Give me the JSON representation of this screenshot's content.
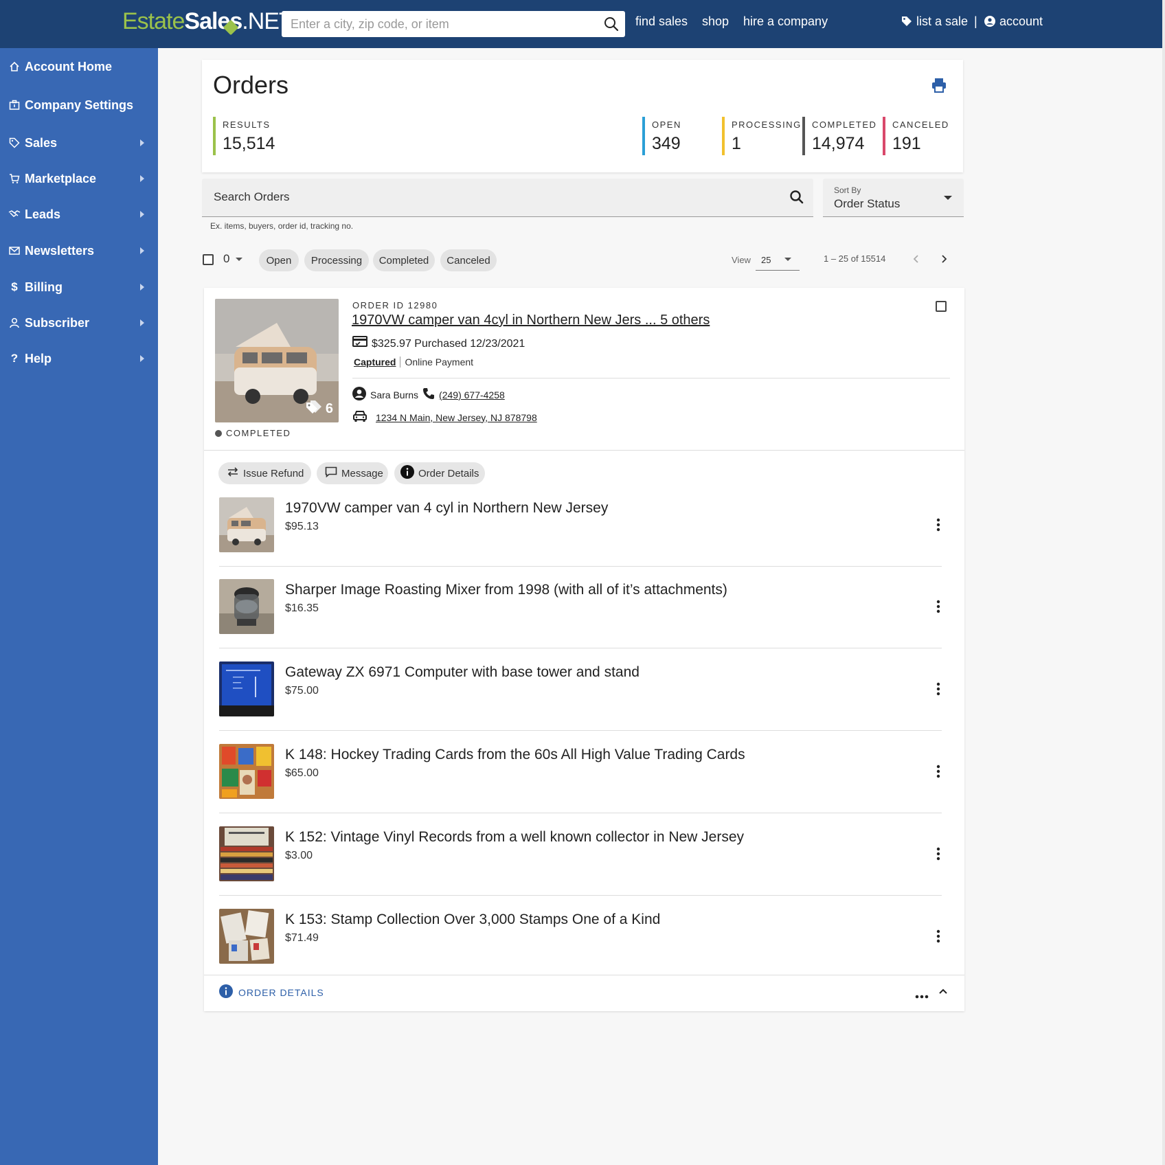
{
  "site": {
    "logo_estate": "Estate",
    "logo_sales": "Sales",
    "logo_net": ".NET",
    "search_placeholder": "Enter a city, zip code, or item",
    "nav": {
      "find_sales": "find sales",
      "shop": "shop",
      "hire": "hire a company",
      "list_sale": "list a sale",
      "account": "account",
      "divider": "|"
    }
  },
  "sidebar": {
    "items": [
      {
        "label": "Account Home",
        "icon": "home-icon"
      },
      {
        "label": "Company Settings",
        "icon": "building-icon"
      },
      {
        "label": "Sales",
        "icon": "tag-icon"
      },
      {
        "label": "Marketplace",
        "icon": "cart-icon"
      },
      {
        "label": "Leads",
        "icon": "handshake-icon"
      },
      {
        "label": "Newsletters",
        "icon": "mail-icon"
      },
      {
        "label": "Billing",
        "icon": "dollar-icon"
      },
      {
        "label": "Subscriber",
        "icon": "user-icon"
      },
      {
        "label": "Help",
        "icon": "question-icon"
      }
    ]
  },
  "page": {
    "title": "Orders",
    "stats": {
      "results": {
        "label": "RESULTS",
        "value": "15,514",
        "color": "#9bc24b"
      },
      "open": {
        "label": "OPEN",
        "value": "349",
        "color": "#2b9fd6"
      },
      "processing": {
        "label": "PROCESSING",
        "value": "1",
        "color": "#f2c12e"
      },
      "completed": {
        "label": "COMPLETED",
        "value": "14,974",
        "color": "#555555"
      },
      "canceled": {
        "label": "CANCELED",
        "value": "191",
        "color": "#d9486b"
      }
    }
  },
  "search": {
    "placeholder": "Search Orders",
    "help": "Ex. items, buyers, order id, tracking no.",
    "sort_label": "Sort By",
    "sort_value": "Order Status"
  },
  "filters": {
    "selected_count": "0",
    "chips": [
      "Open",
      "Processing",
      "Completed",
      "Canceled"
    ],
    "view_label": "View",
    "view_value": "25",
    "range": "1 – 25 of 15514"
  },
  "order": {
    "id_label": "ORDER ID 12980",
    "title": "1970VW camper van 4cyl in Northern New Jers ... 5 others",
    "price_line": "$325.97 Purchased 12/23/2021",
    "captured": "Captured",
    "payment": "Online Payment",
    "buyer": "Sara Burns",
    "phone": "(249) 677-4258",
    "address": "1234 N Main, New Jersey, NJ 878798",
    "tag_count": "6",
    "status": "COMPLETED",
    "actions": {
      "refund": "Issue Refund",
      "message": "Message",
      "details": "Order Details"
    },
    "items": [
      {
        "title": "1970VW camper van 4 cyl in Northern New Jersey",
        "price": "$95.13"
      },
      {
        "title": "Sharper Image Roasting Mixer from 1998 (with all of it’s attachments)",
        "price": "$16.35"
      },
      {
        "title": "Gateway ZX 6971 Computer with base tower and stand",
        "price": "$75.00"
      },
      {
        "title": "K 148: Hockey Trading Cards from the 60s All High Value Trading Cards",
        "price": "$65.00"
      },
      {
        "title": "K 152: Vintage Vinyl Records from a well known collector in New Jersey",
        "price": "$3.00"
      },
      {
        "title": "K 153: Stamp Collection Over 3,000 Stamps One of a Kind",
        "price": "$71.49"
      }
    ],
    "footer_label": "ORDER DETAILS"
  }
}
